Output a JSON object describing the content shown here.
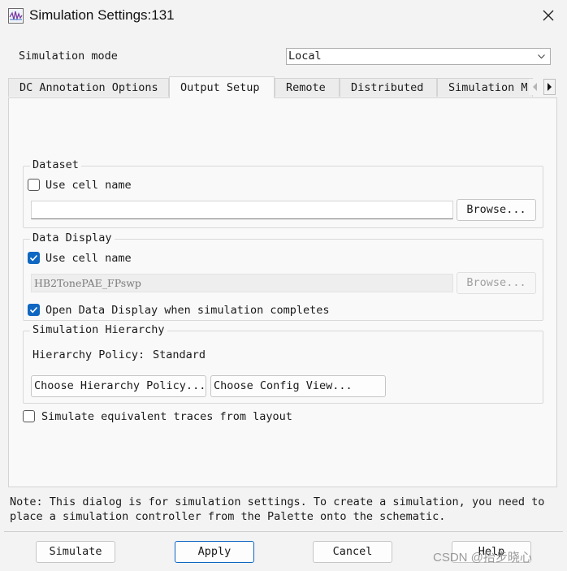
{
  "window": {
    "title": "Simulation Settings:131",
    "icon": "simulation-waveform-icon",
    "close_icon": "close-icon"
  },
  "mode": {
    "label": "Simulation mode",
    "value": "Local"
  },
  "tabs": [
    {
      "label": "DC Annotation Options",
      "active": false
    },
    {
      "label": "Output Setup",
      "active": true
    },
    {
      "label": "Remote",
      "active": false
    },
    {
      "label": "Distributed",
      "active": false
    },
    {
      "label": "Simulation M",
      "active": false
    }
  ],
  "dataset": {
    "legend": "Dataset",
    "use_cell_name": {
      "label": "Use cell name",
      "checked": false
    },
    "path_value": "",
    "browse_label": "Browse..."
  },
  "data_display": {
    "legend": "Data Display",
    "use_cell_name": {
      "label": "Use cell name",
      "checked": true
    },
    "path_value": "HB2TonePAE_FPswp",
    "browse_label": "Browse...",
    "open_when_complete": {
      "label": "Open Data Display when simulation completes",
      "checked": true
    }
  },
  "hierarchy": {
    "legend": "Simulation Hierarchy",
    "policy_label": "Hierarchy Policy:",
    "policy_value": "Standard",
    "choose_policy_label": "Choose Hierarchy Policy...",
    "choose_config_label": "Choose Config View..."
  },
  "simulate_equivalent": {
    "label": "Simulate equivalent traces from layout",
    "checked": false
  },
  "note": {
    "line1": "Note: This dialog is for simulation settings. To create a simulation, you need to",
    "line2": "place a simulation controller from the Palette onto the schematic."
  },
  "buttons": {
    "simulate": "Simulate",
    "apply": "Apply",
    "cancel": "Cancel",
    "help": "Help"
  },
  "watermark": "CSDN @抬步晓心",
  "colors": {
    "accent": "#0f67c2",
    "background": "#f3f3f3"
  }
}
